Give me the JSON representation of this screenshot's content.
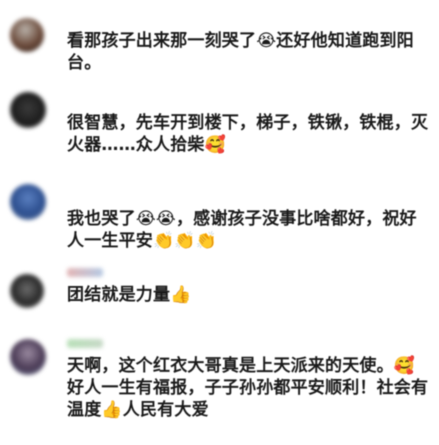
{
  "comments": [
    {
      "text": "看那孩子出来那一刻哭了",
      "emoji": "😭",
      "text2": "还好他知道跑到阳台。"
    },
    {
      "text": "很智慧，先车开到楼下，梯子，铁锹，铁棍，灭火器……众人拾柴",
      "emoji": "🥰"
    },
    {
      "text": "我也哭了",
      "emoji": "😭😭",
      "text2": "，感谢孩子没事比啥都好，祝好人一生平安",
      "emoji2": "👏👏👏"
    },
    {
      "text": "团结就是力量",
      "emoji": "👍"
    },
    {
      "text": "天啊，这个红衣大哥真是上天派来的天使。",
      "emoji": "🥰",
      "text2": "好人一生有福报，子子孙孙都平安顺利！社会有温度",
      "emoji2": "👍",
      "text3": "人民有大爱"
    }
  ]
}
